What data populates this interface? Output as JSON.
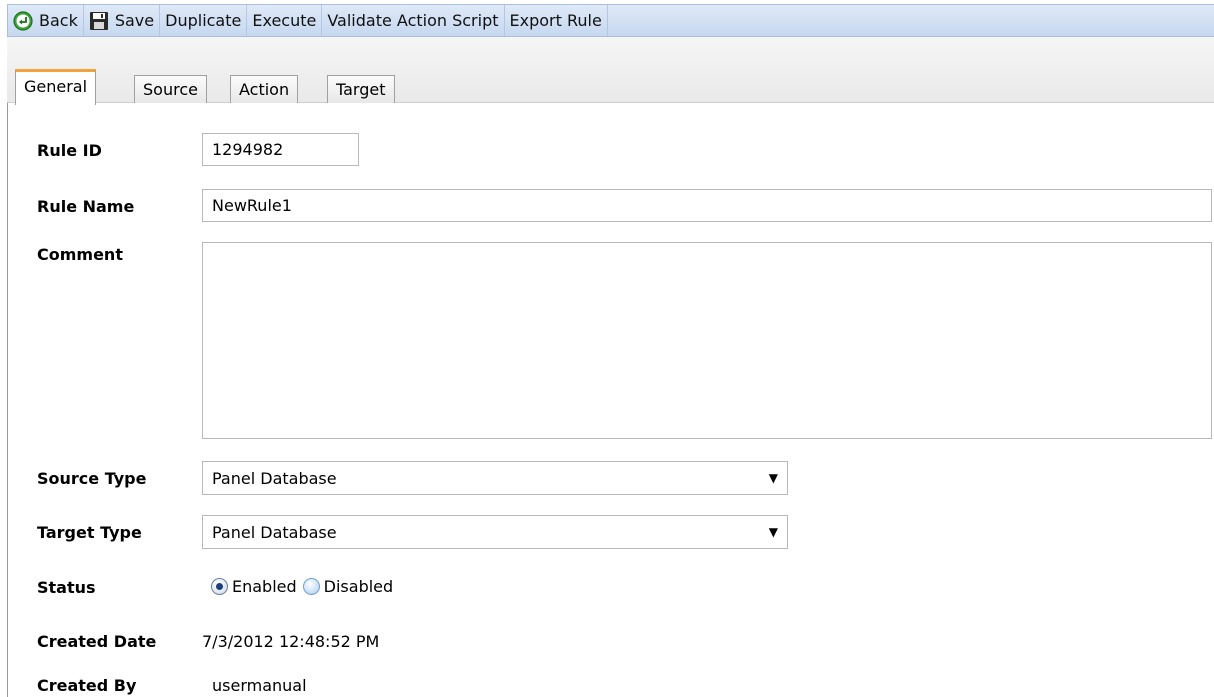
{
  "toolbar": {
    "buttons": [
      {
        "label": "Back",
        "icon": "back-arrow-icon"
      },
      {
        "label": "Save",
        "icon": "floppy-disk-icon"
      },
      {
        "label": "Duplicate"
      },
      {
        "label": "Execute"
      },
      {
        "label": "Validate Action Script"
      },
      {
        "label": "Export Rule"
      }
    ]
  },
  "tabs": [
    {
      "label": "General",
      "active": true
    },
    {
      "label": "Source"
    },
    {
      "label": "Action"
    },
    {
      "label": "Target"
    }
  ],
  "form": {
    "rule_id": {
      "label": "Rule ID",
      "value": "1294982"
    },
    "rule_name": {
      "label": "Rule Name",
      "value": "NewRule1"
    },
    "comment": {
      "label": "Comment",
      "value": ""
    },
    "source_type": {
      "label": "Source Type",
      "value": "Panel Database"
    },
    "target_type": {
      "label": "Target Type",
      "value": "Panel Database"
    },
    "status": {
      "label": "Status",
      "options": [
        "Enabled",
        "Disabled"
      ],
      "selected": "Enabled"
    },
    "created_date": {
      "label": "Created Date",
      "value": "7/3/2012 12:48:52 PM"
    },
    "created_by": {
      "label": "Created By",
      "value": "usermanual"
    }
  },
  "colors": {
    "active_tab_accent": "#f2a33a",
    "toolbar_bg": "#c6d8f0"
  }
}
